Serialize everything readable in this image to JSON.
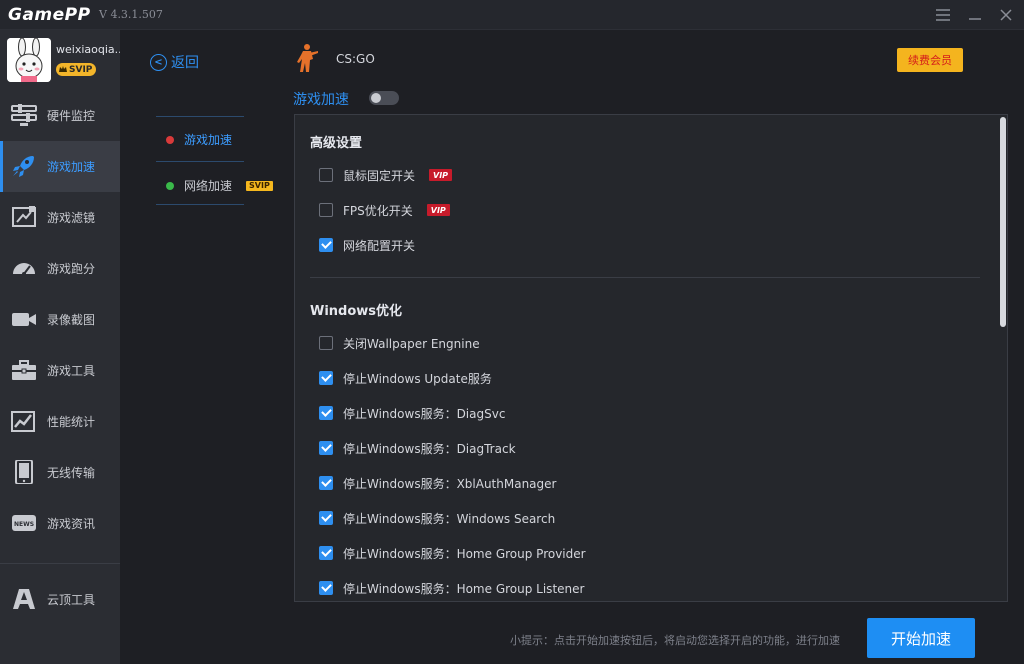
{
  "app": {
    "logo": "GamePP",
    "version": "V 4.3.1.507",
    "window_controls": [
      "menu-icon",
      "minimize-icon",
      "close-icon"
    ]
  },
  "user": {
    "name": "weixiaoqia..",
    "badge": "SVIP"
  },
  "sidebar": {
    "items": [
      {
        "label": "硬件监控",
        "icon": "hardware-monitor-icon",
        "active": false
      },
      {
        "label": "游戏加速",
        "icon": "rocket-icon",
        "active": true
      },
      {
        "label": "游戏滤镜",
        "icon": "filter-icon",
        "active": false
      },
      {
        "label": "游戏跑分",
        "icon": "gauge-icon",
        "active": false
      },
      {
        "label": "录像截图",
        "icon": "video-camera-icon",
        "active": false
      },
      {
        "label": "游戏工具",
        "icon": "toolbox-icon",
        "active": false
      },
      {
        "label": "性能统计",
        "icon": "stats-chart-icon",
        "active": false
      },
      {
        "label": "无线传输",
        "icon": "tablet-icon",
        "active": false
      },
      {
        "label": "游戏资讯",
        "icon": "news-icon",
        "active": false
      }
    ],
    "bottom_item": {
      "label": "云顶工具",
      "icon": "tft-icon"
    }
  },
  "back_label": "返回",
  "subnav": [
    {
      "label": "游戏加速",
      "dot_color": "#d93a3a",
      "active": true
    },
    {
      "label": "网络加速",
      "dot_color": "#3ab94a",
      "active": false,
      "tag": "SVIP"
    }
  ],
  "game": {
    "name": "CS:GO",
    "icon": "counter-strike-icon",
    "renew_label": "续费会员"
  },
  "accel": {
    "title": "游戏加速",
    "enabled": false
  },
  "advanced": {
    "title": "高级设置",
    "options": [
      {
        "label": "鼠标固定开关",
        "checked": false,
        "vip": "VIP"
      },
      {
        "label": "FPS优化开关",
        "checked": false,
        "vip": "VIP"
      },
      {
        "label": "网络配置开关",
        "checked": true
      }
    ]
  },
  "windows_opt": {
    "title": "Windows优化",
    "options": [
      {
        "label": "关闭Wallpaper Engnine",
        "checked": false
      },
      {
        "label": "停止Windows Update服务",
        "checked": true
      },
      {
        "label": "停止Windows服务：DiagSvc",
        "checked": true
      },
      {
        "label": "停止Windows服务：DiagTrack",
        "checked": true
      },
      {
        "label": "停止Windows服务：XblAuthManager",
        "checked": true
      },
      {
        "label": "停止Windows服务：Windows Search",
        "checked": true
      },
      {
        "label": "停止Windows服务：Home Group Provider",
        "checked": true
      },
      {
        "label": "停止Windows服务：Home Group Listener",
        "checked": true
      }
    ]
  },
  "footer": {
    "hint": "小提示：点击开始加速按钮后，将启动您选择开启的功能，进行加速",
    "start_label": "开始加速"
  },
  "colors": {
    "accent": "#2e8ff0",
    "vip_red": "#c71b2b",
    "gold": "#f4b41e"
  }
}
